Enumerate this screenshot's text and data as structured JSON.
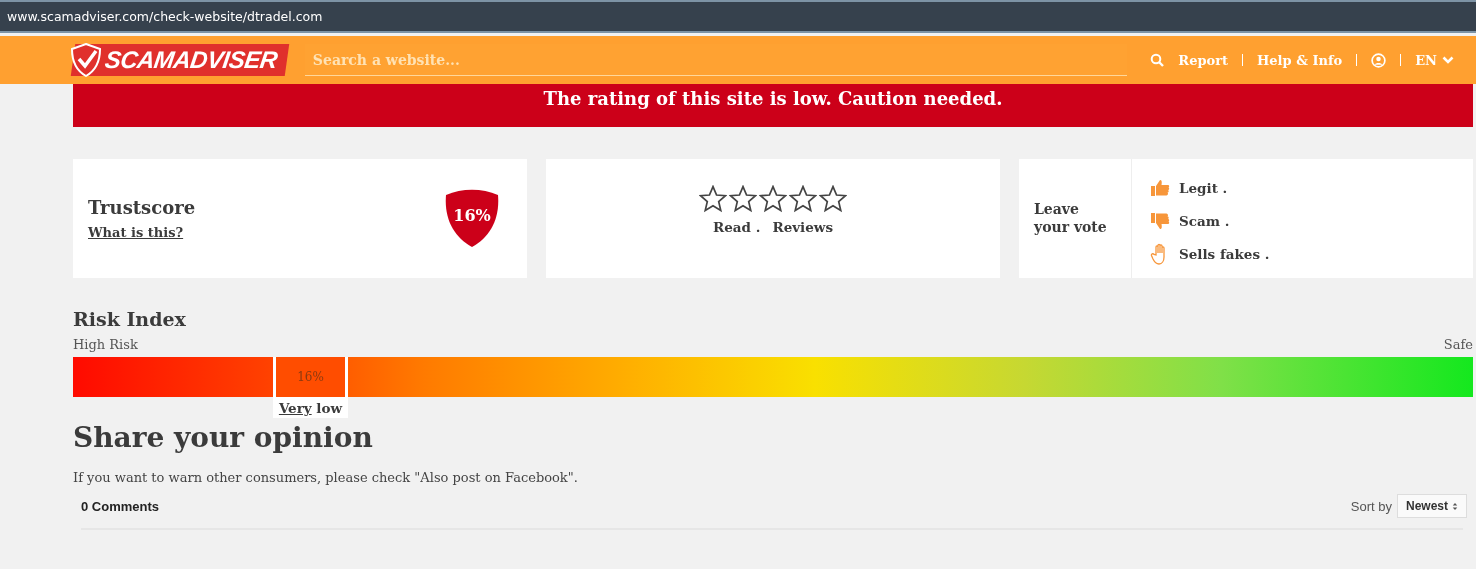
{
  "address_bar": {
    "url": "www.scamadviser.com/check-website/dtradel.com"
  },
  "header": {
    "logo": "SCAMADVISER",
    "search": {
      "placeholder": "Search a website..."
    },
    "nav": [
      {
        "kind": "search"
      },
      {
        "kind": "link",
        "label": "Report"
      },
      {
        "kind": "link",
        "label": "Help & Info"
      },
      {
        "kind": "user"
      },
      {
        "kind": "lang",
        "label": "EN"
      }
    ]
  },
  "banner": "The rating of this site is low. Caution needed.",
  "trustscore": {
    "title": "Trustscore",
    "link": "What is this?",
    "score": "16%"
  },
  "reviews": {
    "stars": 0,
    "read": "Read .",
    "reviews": "Reviews"
  },
  "vote": {
    "title": "Leave your vote",
    "options": [
      {
        "kind": "up",
        "label": "Legit ."
      },
      {
        "kind": "down",
        "label": "Scam ."
      },
      {
        "kind": "hand",
        "label": "Sells fakes ."
      }
    ]
  },
  "risk_index": {
    "title": "Risk Index",
    "left_label": "High Risk",
    "right_label": "Safe",
    "level": 0.16,
    "marker": "16%",
    "rating_underlined": "Very",
    "rating_rest": "low"
  },
  "opinion": {
    "title": "Share your opinion",
    "note": "If you want to warn other consumers, please check \"Also post on Facebook\".",
    "comments": "0 Comments",
    "sort_label": "Sort by",
    "sort_value": "Newest"
  }
}
